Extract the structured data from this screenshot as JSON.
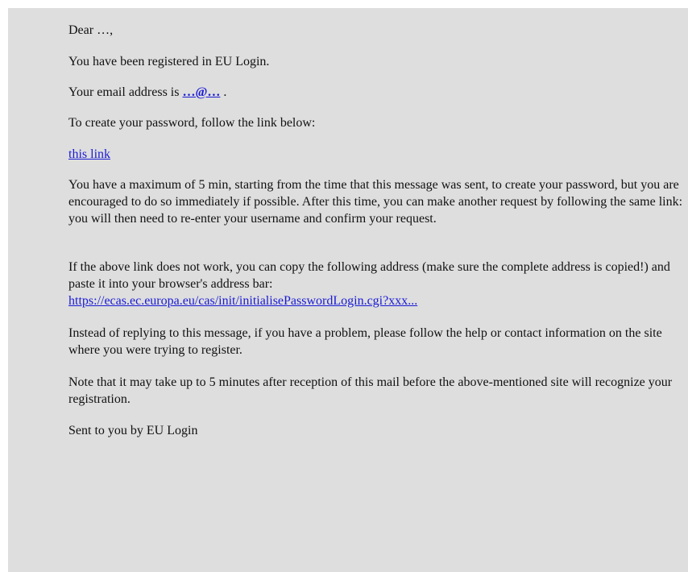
{
  "email": {
    "greeting": "Dear …,",
    "registered": "You have been registered in EU Login.",
    "email_prefix": "Your email address is ",
    "email_link": "…@…",
    "email_suffix": " .",
    "create_password": "To create your password, follow the link below:",
    "this_link": "this link",
    "time_limit": "You have a maximum of 5 min, starting from the time that this message was sent, to create your password, but you are encouraged to do so immediately if possible. After this time, you can make another request by following the same link: you will then need to re-enter your username and confirm your request.",
    "copy_address": "If the above link does not work, you can copy the following address (make sure the complete address is copied!) and paste it into your browser's address bar:",
    "address_link": "https://ecas.ec.europa.eu/cas/init/initialisePasswordLogin.cgi?xxx...",
    "help": "Instead of replying to this message, if you have a problem, please follow the help or contact information on the site where you were trying to register.",
    "note": "Note that it may take up to 5 minutes after reception of this mail before the above-mentioned site will recognize your registration.",
    "signature": "Sent to you by EU Login"
  }
}
